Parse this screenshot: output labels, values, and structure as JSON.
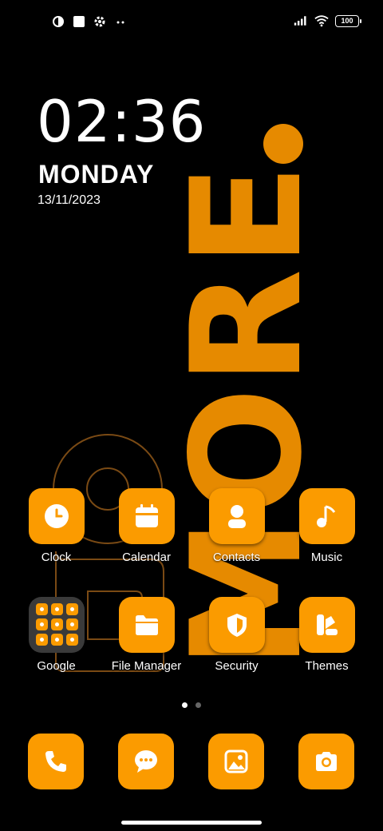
{
  "wallpaper": {
    "text": "MORE",
    "accent": "#e68a00"
  },
  "status_bar": {
    "left_icons": [
      "record-icon",
      "square-icon",
      "settings-gear-icon",
      "more-dots-icon"
    ],
    "right_icons": [
      "signal-icon",
      "wifi-icon",
      "battery-icon"
    ],
    "battery_level": "100"
  },
  "clock_widget": {
    "time": "02:36",
    "day": "MONDAY",
    "date": "13/11/2023"
  },
  "apps": [
    {
      "label": "Clock",
      "icon": "clock-icon"
    },
    {
      "label": "Calendar",
      "icon": "calendar-icon"
    },
    {
      "label": "Contacts",
      "icon": "person-icon"
    },
    {
      "label": "Music",
      "icon": "music-note-icon"
    },
    {
      "label": "Google",
      "icon": "folder-icon"
    },
    {
      "label": "File Manager",
      "icon": "folder-icon"
    },
    {
      "label": "Security",
      "icon": "shield-icon"
    },
    {
      "label": "Themes",
      "icon": "palette-icon"
    }
  ],
  "pager": {
    "pages": 2,
    "current": 1
  },
  "dock": [
    {
      "icon": "phone-icon"
    },
    {
      "icon": "message-icon"
    },
    {
      "icon": "gallery-icon"
    },
    {
      "icon": "camera-icon"
    }
  ],
  "colors": {
    "icon_background": "#fb9b00",
    "folder_background": "#3a3a3a"
  }
}
